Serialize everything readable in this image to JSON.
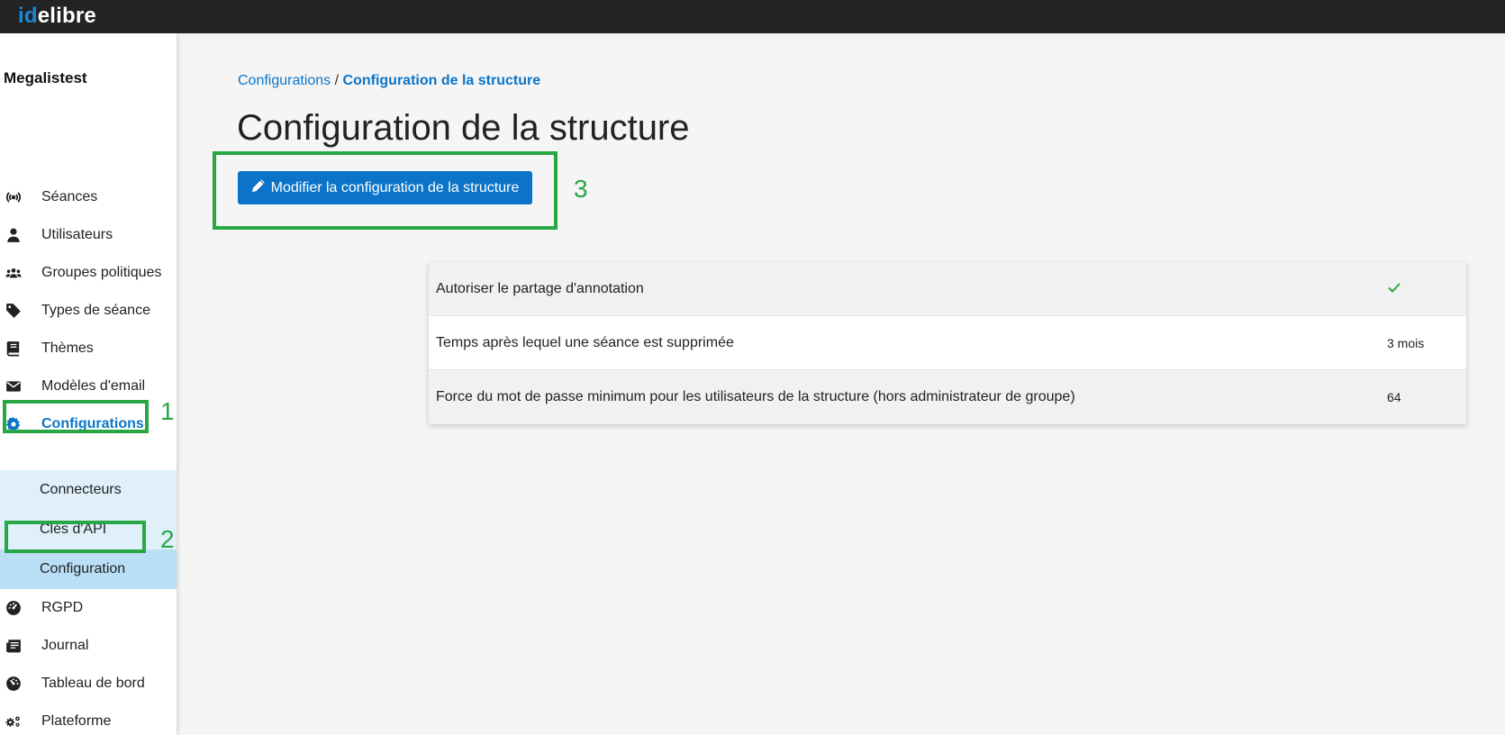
{
  "app": {
    "logo_prefix": "id",
    "logo_suffix": "elibre"
  },
  "sidebar": {
    "structure_name": "Megalistest",
    "items": [
      {
        "label": "Séances",
        "icon": "podcast-icon"
      },
      {
        "label": "Utilisateurs",
        "icon": "user-icon"
      },
      {
        "label": "Groupes politiques",
        "icon": "users-icon"
      },
      {
        "label": "Types de séance",
        "icon": "tag-icon"
      },
      {
        "label": "Thèmes",
        "icon": "book-icon"
      },
      {
        "label": "Modèles d'email",
        "icon": "envelope-icon"
      },
      {
        "label": "Configurations",
        "icon": "gear-icon",
        "active": true
      },
      {
        "label": "RGPD",
        "icon": "gauge-icon"
      },
      {
        "label": "Journal",
        "icon": "newspaper-icon"
      },
      {
        "label": "Tableau de bord",
        "icon": "dashboard-icon"
      },
      {
        "label": "Plateforme",
        "icon": "gears-icon"
      }
    ],
    "sub_items": [
      {
        "label": "Connecteurs"
      },
      {
        "label": "Clés d'API"
      },
      {
        "label": "Configuration",
        "selected": true
      }
    ]
  },
  "annotations": {
    "one": "1",
    "two": "2",
    "three": "3"
  },
  "breadcrumb": {
    "parent": "Configurations",
    "separator": " / ",
    "current": "Configuration de la structure"
  },
  "page_title": "Configuration de la structure",
  "edit_button": {
    "label": "Modifier la configuration de la structure",
    "icon": "pencil-icon"
  },
  "config_rows": [
    {
      "label": "Autoriser le partage d'annotation",
      "value_icon": "check-icon"
    },
    {
      "label": "Temps après lequel une séance est supprimée",
      "value": "3 mois"
    },
    {
      "label": "Force du mot de passe minimum pour les utilisateurs de la structure (hors administrateur de groupe)",
      "value": "64"
    }
  ],
  "colors": {
    "accent": "#0b74c8",
    "highlight": "#28a745",
    "topbar": "#232323",
    "submenu": "#dff0fb",
    "submenu_selected": "#b9def6"
  }
}
